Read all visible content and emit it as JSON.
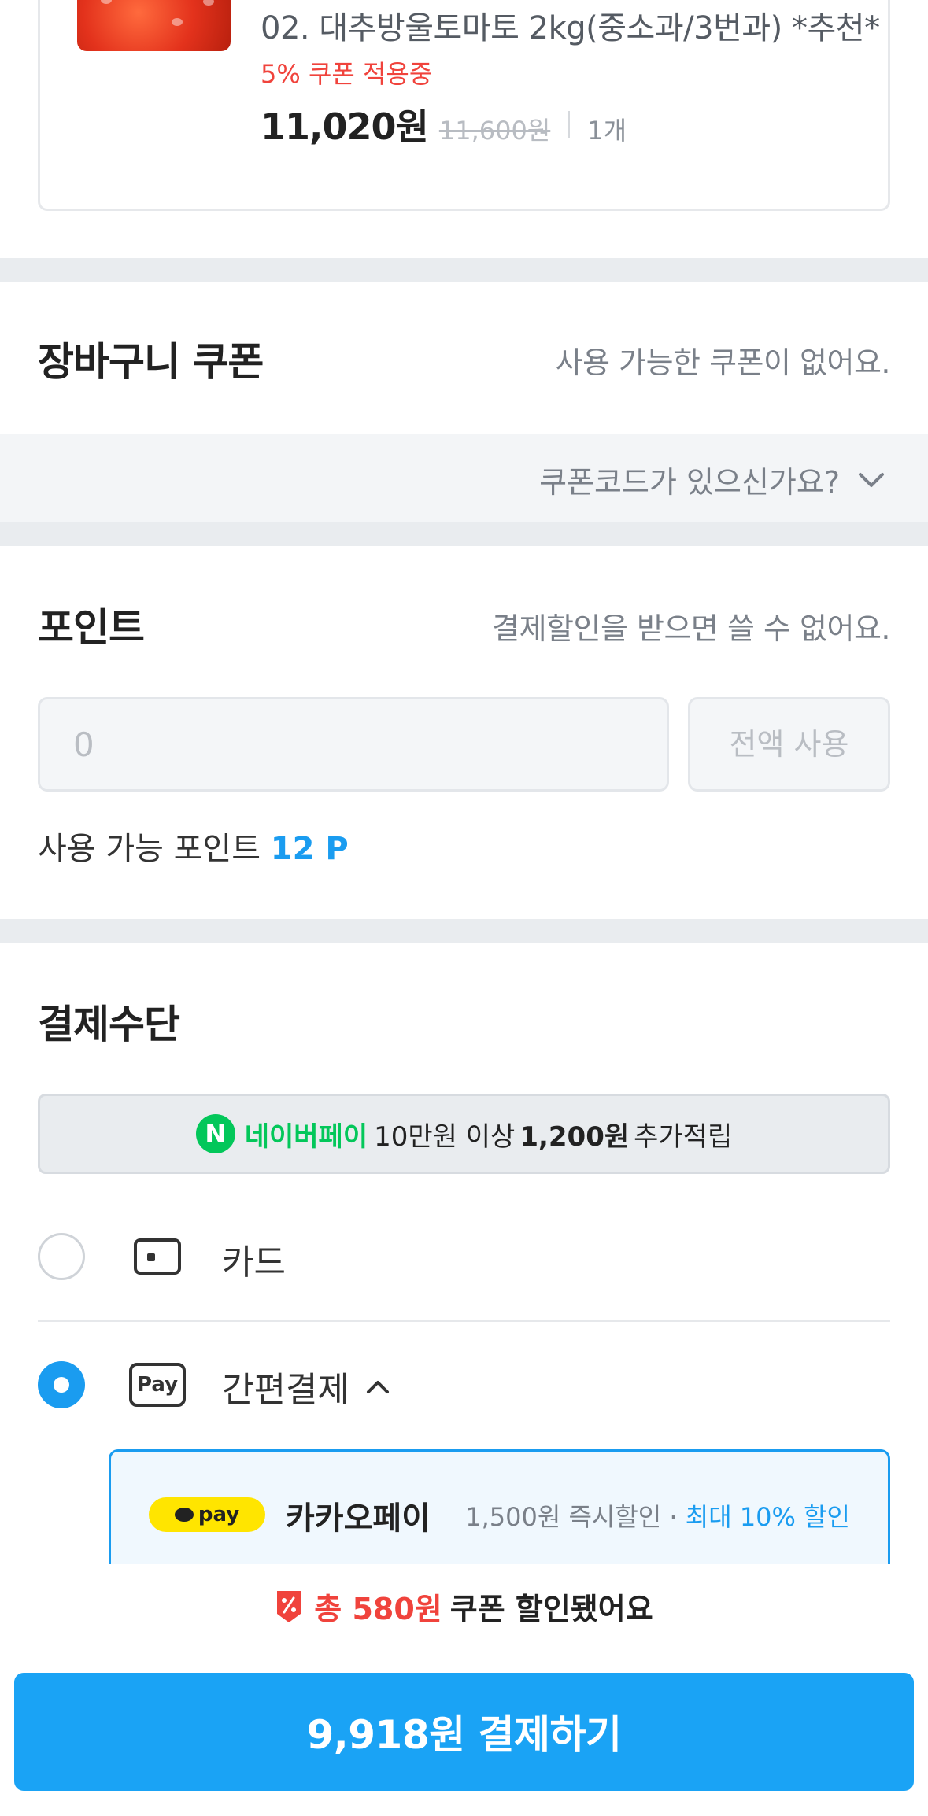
{
  "product": {
    "name": "02. 대추방울토마토 2kg(중소과/3번과) *추천*",
    "coupon_applied": "5% 쿠폰 적용중",
    "price": "11,020원",
    "original_price": "11,600원",
    "quantity": "1개"
  },
  "cart_coupon": {
    "title": "장바구니 쿠폰",
    "note": "사용 가능한 쿠폰이 없어요.",
    "code_prompt": "쿠폰코드가 있으신가요?"
  },
  "points": {
    "title": "포인트",
    "note": "결제할인을 받으면 쓸 수 없어요.",
    "input_placeholder": "0",
    "use_all_label": "전액 사용",
    "available_label": "사용 가능 포인트",
    "available_value": "12 P"
  },
  "payment": {
    "title": "결제수단",
    "naver_banner": {
      "icon": "N",
      "name": "네이버페이",
      "text1": "10만원 이상",
      "amount": "1,200원",
      "text2": "추가적립"
    },
    "methods": [
      {
        "label": "카드",
        "icon": "card-icon",
        "selected": false
      },
      {
        "label": "간편결제",
        "icon": "pay-icon",
        "selected": true
      }
    ],
    "pay_icon_text": "Pay",
    "kakao": {
      "badge": "pay",
      "name": "카카오페이",
      "benefit": "1,500원 즉시할인 · ",
      "benefit_highlight": "최대 10% 할인"
    }
  },
  "summary": {
    "prefix": "총 580원",
    "suffix": "쿠폰 할인됐어요",
    "pay_button": "9,918원 결제하기"
  },
  "colors": {
    "accent": "#1a9cf0",
    "discount_red": "#f0433c",
    "naver_green": "#03c75a",
    "kakao_yellow": "#ffe500"
  }
}
